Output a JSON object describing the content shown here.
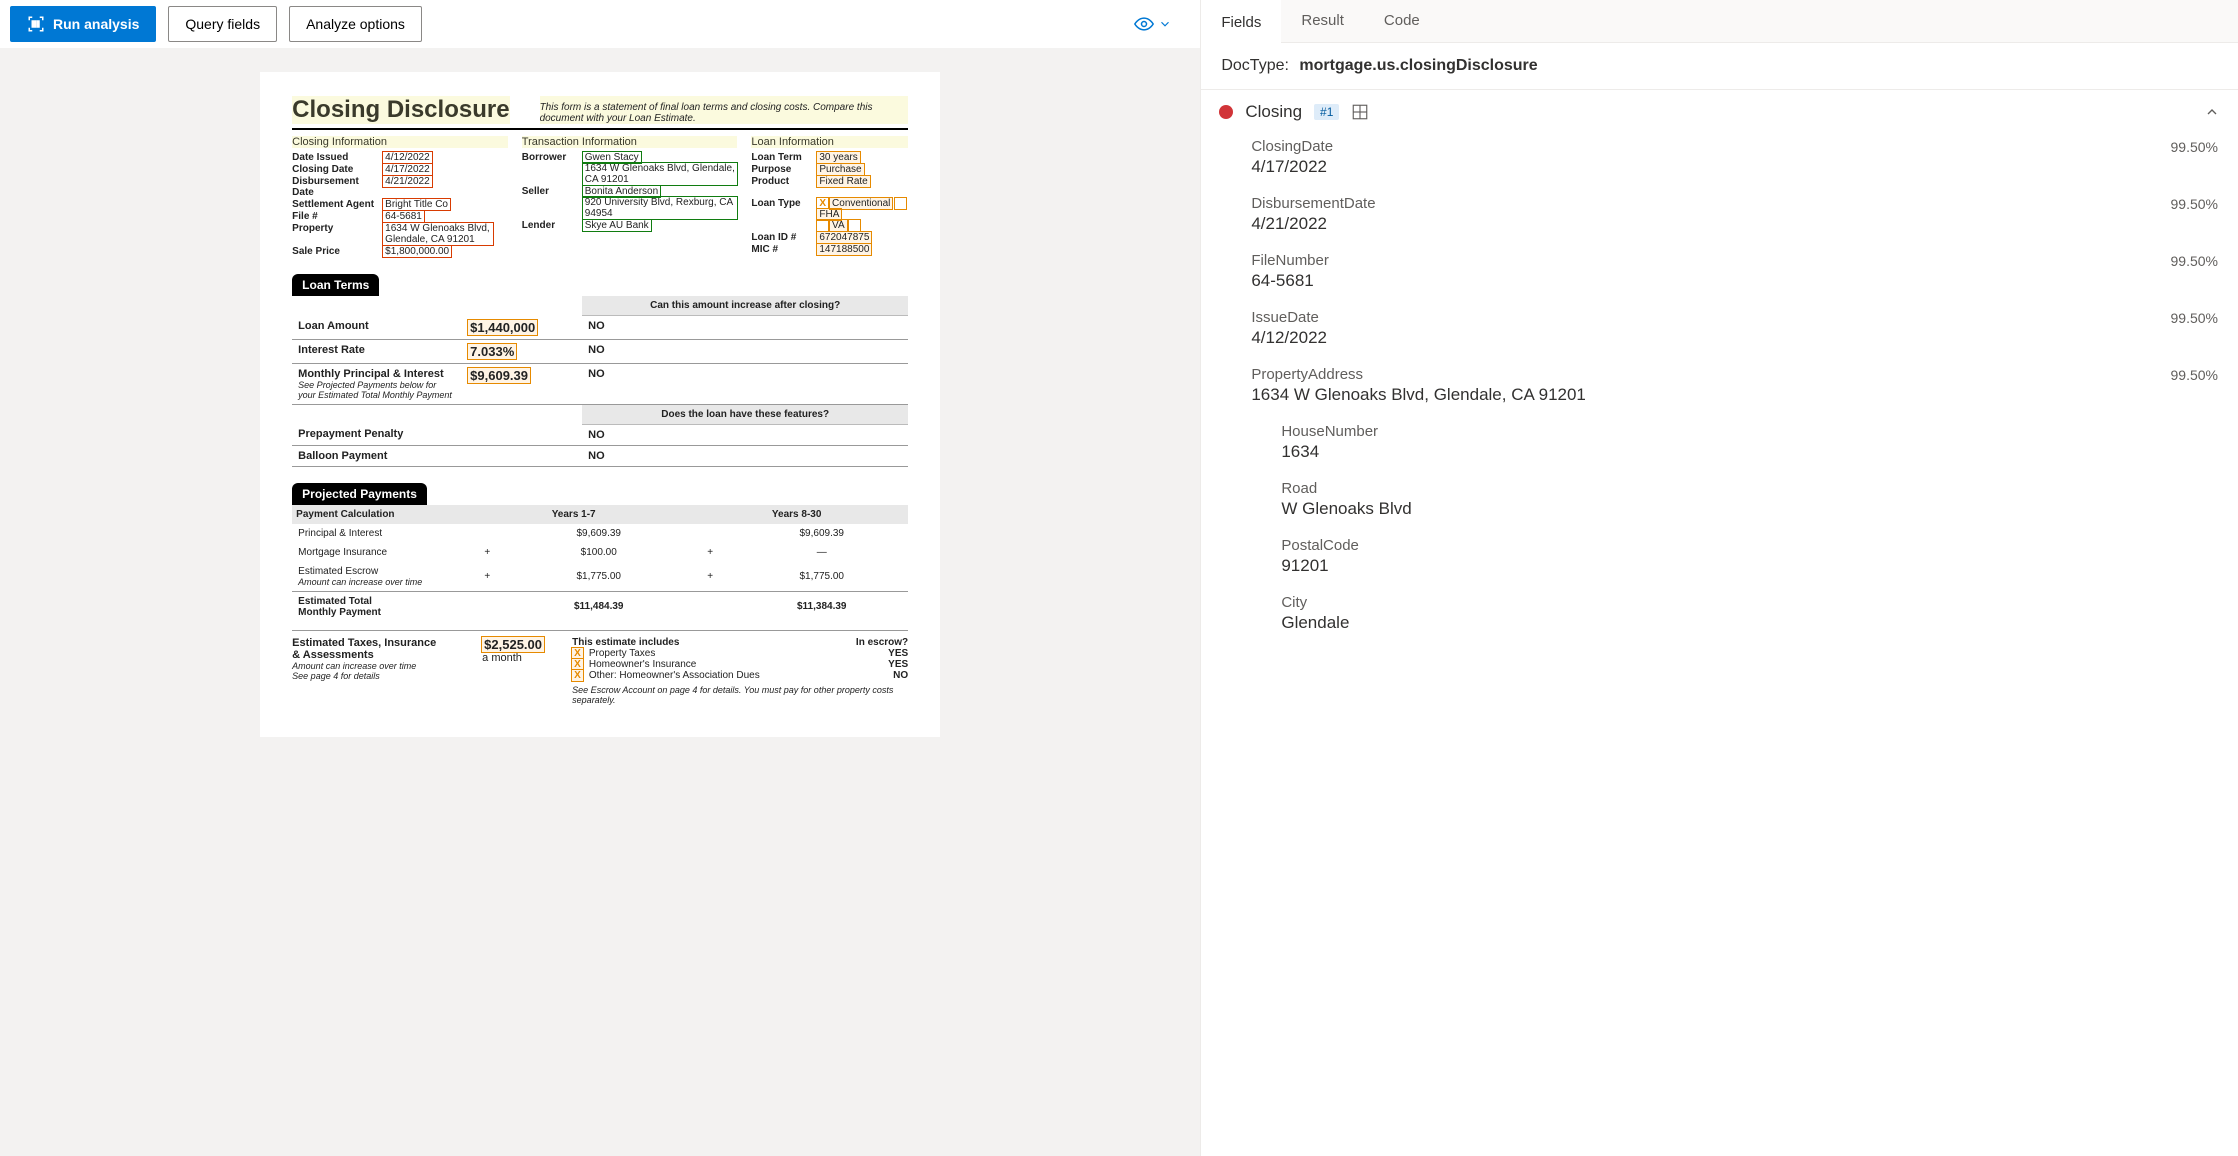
{
  "toolbar": {
    "run": "Run analysis",
    "query": "Query fields",
    "analyze": "Analyze options"
  },
  "doc": {
    "title": "Closing Disclosure",
    "note": "This form is a statement of final loan terms and closing costs. Compare this document with your Loan Estimate.",
    "closing": {
      "head": "Closing  Information",
      "dateIssuedL": "Date Issued",
      "dateIssued": "4/12/2022",
      "closingDateL": "Closing Date",
      "closingDate": "4/17/2022",
      "disbDateL": "Disbursement Date",
      "disbDate": "4/21/2022",
      "settleAgentL": "Settlement Agent",
      "settleAgent": "Bright Title Co",
      "fileNoL": "File #",
      "fileNo": "64-5681",
      "propertyL": "Property",
      "property": "1634 W Glenoaks Blvd, Glendale, CA 91201",
      "salePriceL": "Sale Price",
      "salePrice": "$1,800,000.00"
    },
    "trans": {
      "head": "Transaction  Information",
      "borrowerL": "Borrower",
      "borrowerName": "Gwen Stacy",
      "borrowerAddr": "1634 W Glenoaks Blvd, Glendale, CA 91201",
      "sellerL": "Seller",
      "sellerName": "Bonita Anderson",
      "sellerAddr": "920 University Blvd, Rexburg, CA 94954",
      "lenderL": "Lender",
      "lender": "Skye AU Bank"
    },
    "loan": {
      "head": "Loan  Information",
      "termL": "Loan Term",
      "term": "30 years",
      "purposeL": "Purpose",
      "purpose": "Purchase",
      "productL": "Product",
      "product": "Fixed Rate",
      "typeL": "Loan Type",
      "typeConv": "Conventional",
      "typeFHA": "FHA",
      "typeVA": "VA",
      "loanIdL": "Loan ID #",
      "loanId": "672047875",
      "micL": "MIC #",
      "mic": "147188500"
    },
    "lt": {
      "header": "Loan Terms",
      "q1": "Can this amount increase after closing?",
      "r1L": "Loan Amount",
      "r1V": "$1,440,000",
      "r1A": "NO",
      "r2L": "Interest Rate",
      "r2V": "7.033%",
      "r2A": "NO",
      "r3L": "Monthly Principal & Interest",
      "r3V": "$9,609.39",
      "r3A": "NO",
      "r3Note": "See Projected Payments below for your Estimated Total Monthly Payment",
      "q2": "Does the loan have these features?",
      "r4L": "Prepayment Penalty",
      "r4A": "NO",
      "r5L": "Balloon Payment",
      "r5A": "NO"
    },
    "pp": {
      "header": "Projected Payments",
      "calcL": "Payment Calculation",
      "y1": "Years 1-7",
      "y2": "Years 8-30",
      "piL": "Principal & Interest",
      "pi1": "$9,609.39",
      "pi2": "$9,609.39",
      "miL": "Mortgage Insurance",
      "mi1": "$100.00",
      "mi2": "—",
      "eeL": "Estimated Escrow",
      "eeNote": "Amount can increase over time",
      "ee1": "$1,775.00",
      "ee2": "$1,775.00",
      "plus": "+",
      "etL1": "Estimated Total",
      "etL2": "Monthly Payment",
      "et1": "$11,484.39",
      "et2": "$11,384.39"
    },
    "eti": {
      "l1": "Estimated Taxes, Insurance",
      "l2": "& Assessments",
      "note1": "Amount can increase over time",
      "note2": "See page 4 for details",
      "amount": "$2,525.00",
      "per": "a month",
      "incHead": "This estimate includes",
      "escHead": "In escrow?",
      "i1": "Property Taxes",
      "e1": "YES",
      "i2": "Homeowner's Insurance",
      "e2": "YES",
      "i3": "Other: Homeowner's Association Dues",
      "e3": "NO",
      "foot": "See Escrow Account on page 4 for details. You must pay for other property costs separately."
    }
  },
  "panel": {
    "tabs": {
      "fields": "Fields",
      "result": "Result",
      "code": "Code"
    },
    "docTypeL": "DocType:",
    "docType": "mortgage.us.closingDisclosure",
    "group": {
      "name": "Closing",
      "badge": "#1"
    },
    "fields": [
      {
        "name": "ClosingDate",
        "conf": "99.50%",
        "value": "4/17/2022"
      },
      {
        "name": "DisbursementDate",
        "conf": "99.50%",
        "value": "4/21/2022"
      },
      {
        "name": "FileNumber",
        "conf": "99.50%",
        "value": "64-5681"
      },
      {
        "name": "IssueDate",
        "conf": "99.50%",
        "value": "4/12/2022"
      },
      {
        "name": "PropertyAddress",
        "conf": "99.50%",
        "value": "1634 W Glenoaks Blvd, Glendale, CA 91201"
      }
    ],
    "sub": [
      {
        "name": "HouseNumber",
        "value": "1634"
      },
      {
        "name": "Road",
        "value": "W Glenoaks Blvd"
      },
      {
        "name": "PostalCode",
        "value": "91201"
      },
      {
        "name": "City",
        "value": "Glendale"
      }
    ]
  }
}
